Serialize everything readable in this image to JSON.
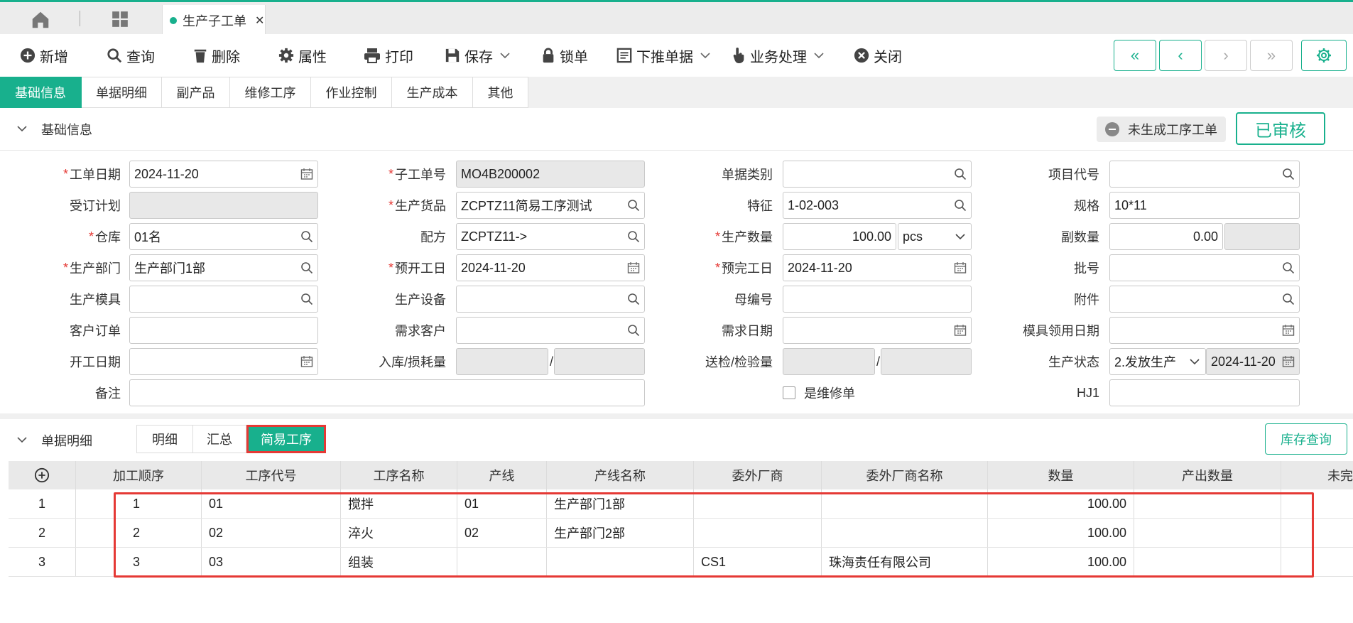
{
  "window": {
    "active_tab": "生产子工单"
  },
  "toolbar": {
    "new": "新增",
    "query": "查询",
    "delete": "删除",
    "properties": "属性",
    "print": "打印",
    "save": "保存",
    "lock": "锁单",
    "push_down": "下推单据",
    "business": "业务处理",
    "close": "关闭",
    "nav_first": "«",
    "nav_prev": "‹",
    "nav_next": "›",
    "nav_last": "»"
  },
  "subtabs": [
    "基础信息",
    "单据明细",
    "副产品",
    "维修工序",
    "作业控制",
    "生产成本",
    "其他"
  ],
  "basic_section": {
    "title": "基础信息",
    "status_chip": "未生成工序工单",
    "approved": "已审核"
  },
  "form": {
    "work_date": {
      "label": "工单日期",
      "value": "2024-11-20"
    },
    "sub_order_no": {
      "label": "子工单号",
      "value": "MO4B200002"
    },
    "doc_type": {
      "label": "单据类别",
      "value": ""
    },
    "project_code": {
      "label": "项目代号",
      "value": ""
    },
    "order_plan": {
      "label": "受订计划",
      "value": ""
    },
    "product": {
      "label": "生产货品",
      "value": "ZCPTZ11简易工序测试"
    },
    "feature": {
      "label": "特征",
      "value": "1-02-003"
    },
    "spec": {
      "label": "规格",
      "value": "10*11"
    },
    "warehouse": {
      "label": "仓库",
      "value": "01名"
    },
    "formula": {
      "label": "配方",
      "value": "ZCPTZ11->"
    },
    "prod_qty": {
      "label": "生产数量",
      "value": "100.00",
      "unit": "pcs"
    },
    "sub_qty": {
      "label": "副数量",
      "value": "0.00"
    },
    "dept": {
      "label": "生产部门",
      "value": "生产部门1部"
    },
    "plan_start": {
      "label": "预开工日",
      "value": "2024-11-20"
    },
    "plan_end": {
      "label": "预完工日",
      "value": "2024-11-20"
    },
    "batch": {
      "label": "批号",
      "value": ""
    },
    "mold": {
      "label": "生产模具",
      "value": ""
    },
    "equipment": {
      "label": "生产设备",
      "value": ""
    },
    "parent_no": {
      "label": "母编号",
      "value": ""
    },
    "attachment": {
      "label": "附件",
      "value": ""
    },
    "customer_order": {
      "label": "客户订单",
      "value": ""
    },
    "demand_customer": {
      "label": "需求客户",
      "value": ""
    },
    "demand_date": {
      "label": "需求日期",
      "value": ""
    },
    "mold_date": {
      "label": "模具领用日期",
      "value": ""
    },
    "start_date": {
      "label": "开工日期",
      "value": ""
    },
    "in_loss": {
      "label": "入库/损耗量",
      "value1": "",
      "value2": ""
    },
    "inspect": {
      "label": "送检/检验量",
      "value1": "",
      "value2": ""
    },
    "prod_status": {
      "label": "生产状态",
      "value": "2.发放生产",
      "date": "2024-11-20"
    },
    "remark": {
      "label": "备注",
      "value": ""
    },
    "is_repair": {
      "label": "是维修单"
    },
    "hj1": {
      "label": "HJ1",
      "value": ""
    },
    "slash": "/"
  },
  "detail_section": {
    "title": "单据明细",
    "segments": [
      "明细",
      "汇总",
      "简易工序"
    ],
    "stock_button": "库存查询"
  },
  "table": {
    "columns": [
      "加工顺序",
      "工序代号",
      "工序名称",
      "产线",
      "产线名称",
      "委外厂商",
      "委外厂商名称",
      "数量",
      "产出数量",
      "未完"
    ],
    "rows": [
      {
        "idx": "1",
        "seq": "1",
        "code": "01",
        "name": "搅拌",
        "line": "01",
        "line_name": "生产部门1部",
        "vendor": "",
        "vendor_name": "",
        "qty": "100.00",
        "out_qty": ""
      },
      {
        "idx": "2",
        "seq": "2",
        "code": "02",
        "name": "淬火",
        "line": "02",
        "line_name": "生产部门2部",
        "vendor": "",
        "vendor_name": "",
        "qty": "100.00",
        "out_qty": ""
      },
      {
        "idx": "3",
        "seq": "3",
        "code": "03",
        "name": "组装",
        "line": "",
        "line_name": "",
        "vendor": "CS1",
        "vendor_name": "珠海责任有限公司",
        "qty": "100.00",
        "out_qty": ""
      }
    ]
  },
  "colors": {
    "accent": "#18b08d",
    "highlight": "#e53935"
  }
}
